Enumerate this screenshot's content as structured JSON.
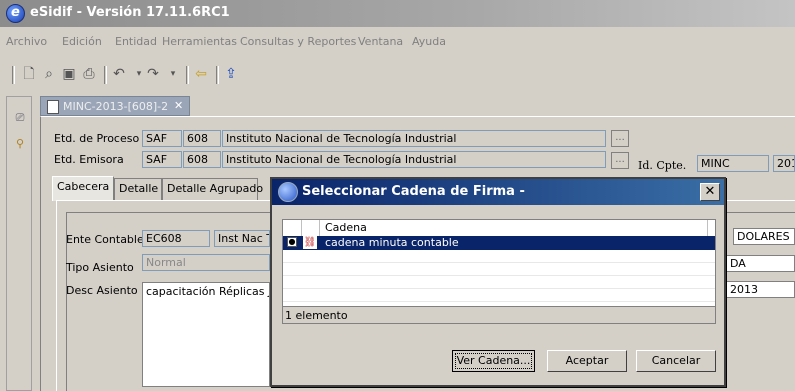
{
  "app": {
    "title": "eSidif - Versión 17.11.6RC1"
  },
  "menu": [
    "Archivo",
    "Edición",
    "Entidad",
    "Herramientas",
    "Consultas y Reportes",
    "Ventana",
    "Ayuda"
  ],
  "document_tab": {
    "label": "MINC-2013-[608]-2",
    "close": "✕"
  },
  "header": {
    "etd_proceso": {
      "label": "Etd. de Proceso",
      "code": "SAF",
      "num": "608",
      "name": "Instituto Nacional de Tecnología Industrial"
    },
    "etd_emisora": {
      "label": "Etd. Emisora",
      "code": "SAF",
      "num": "608",
      "name": "Instituto Nacional de Tecnología Industrial"
    },
    "id_cpte": {
      "label": "Id. Cpte.",
      "value": "MINC",
      "year": "201"
    },
    "ellipsis": "..."
  },
  "tabs": [
    "Cabecera",
    "Detalle",
    "Detalle Agrupado"
  ],
  "form": {
    "ente_contable": {
      "label": "Ente Contable",
      "code": "EC608",
      "name": "Inst Nac T"
    },
    "tipo_asiento": {
      "label": "Tipo Asiento",
      "value": "Normal"
    },
    "desc_asiento": {
      "label": "Desc Asiento",
      "value": "capacitación Réplicas Ju"
    },
    "right_fields": [
      "DOLARES E",
      "DA",
      "2013"
    ]
  },
  "dialog": {
    "title": "Seleccionar Cadena de Firma -",
    "close": "✕",
    "grid": {
      "header": "Cadena",
      "rows": [
        {
          "text": "cadena minuta contable",
          "selected": true
        }
      ],
      "footer": "1 elemento"
    },
    "buttons": {
      "ver": "Ver Cadena...",
      "aceptar": "Aceptar",
      "cancelar": "Cancelar"
    }
  }
}
